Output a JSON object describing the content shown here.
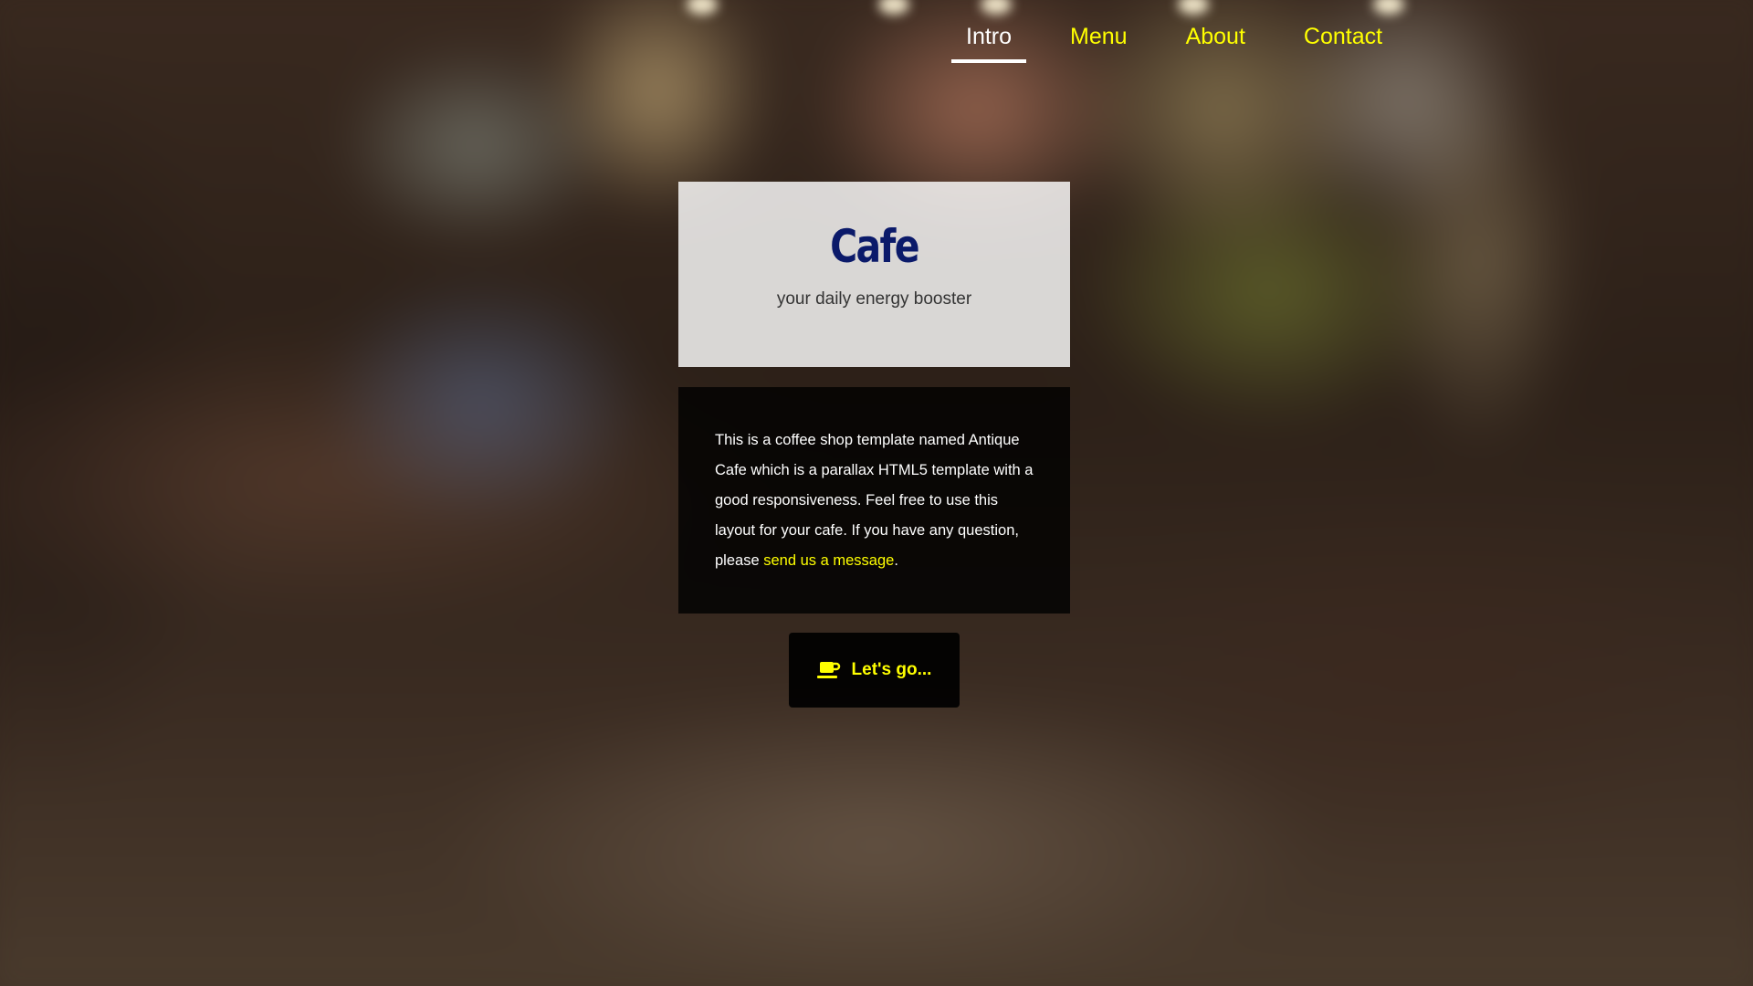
{
  "nav": {
    "items": [
      {
        "label": "Intro",
        "active": true
      },
      {
        "label": "Menu",
        "active": false
      },
      {
        "label": "About",
        "active": false
      },
      {
        "label": "Contact",
        "active": false
      }
    ]
  },
  "hero": {
    "title": "Cafe",
    "subtitle": "your daily energy booster"
  },
  "intro": {
    "text": "This is a coffee shop template named Antique Cafe which is a parallax HTML5 template with a good responsiveness. Feel free to use this layout for your cafe. If you have any question, please ",
    "link_label": "send us a message",
    "text_end": "."
  },
  "cta": {
    "icon": "coffee-cup-icon",
    "label": "Let's go..."
  },
  "colors": {
    "accent": "#ffff00",
    "title": "#0b1a6a",
    "nav_active": "#ffffff"
  }
}
